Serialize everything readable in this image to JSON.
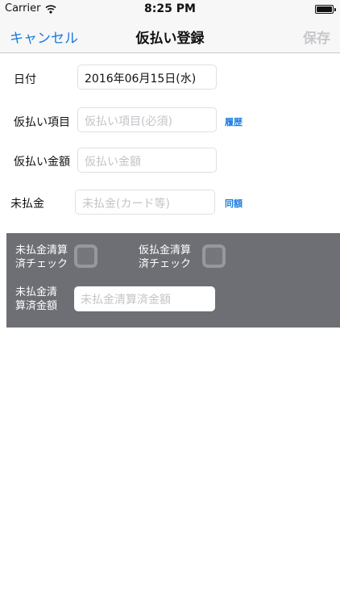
{
  "status_bar": {
    "carrier": "Carrier",
    "time": "8:25 PM"
  },
  "nav": {
    "cancel_label": "キャンセル",
    "title": "仮払い登録",
    "save_label": "保存"
  },
  "form": {
    "date": {
      "label": "日付",
      "value": "2016年06月15日(水)"
    },
    "item": {
      "label": "仮払い項目",
      "placeholder": "仮払い項目(必須)",
      "history_label": "履歴"
    },
    "amount": {
      "label": "仮払い金額",
      "placeholder": "仮払い金額"
    },
    "unpaid": {
      "label": "未払金",
      "placeholder": "未払金(カード等)",
      "same_label": "同額"
    }
  },
  "panel": {
    "unpaid_check_label_line1": "未払金清算",
    "unpaid_check_label_line2": "済チェック",
    "advance_check_label_line1": "仮払金清算",
    "advance_check_label_line2": "済チェック",
    "settled_amount_label_line1": "未払金清",
    "settled_amount_label_line2": "算済金額",
    "settled_amount_placeholder": "未払金清算済金額"
  },
  "colors": {
    "accent": "#1a7be0",
    "panel_bg": "#6e6f74",
    "disabled": "#c7c7cc"
  }
}
